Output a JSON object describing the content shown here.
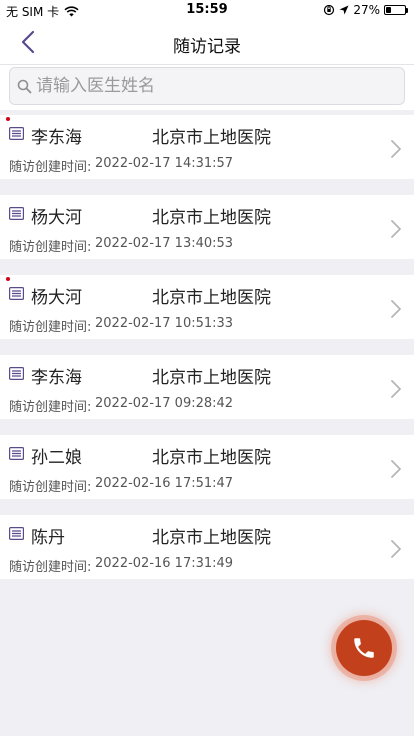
{
  "status_bar": {
    "carrier": "无 SIM 卡",
    "time": "15:59",
    "battery_percent": "27%",
    "battery_level": 0.27
  },
  "nav": {
    "title": "随访记录"
  },
  "search": {
    "placeholder": "请输入医生姓名"
  },
  "records": [
    {
      "name": "李东海",
      "hospital": "北京市上地医院",
      "time_label": "随访创建时间:",
      "time": "2022-02-17 14:31:57",
      "unread": true
    },
    {
      "name": "杨大河",
      "hospital": "北京市上地医院",
      "time_label": "随访创建时间:",
      "time": "2022-02-17 13:40:53",
      "unread": false
    },
    {
      "name": "杨大河",
      "hospital": "北京市上地医院",
      "time_label": "随访创建时间:",
      "time": "2022-02-17 10:51:33",
      "unread": true
    },
    {
      "name": "李东海",
      "hospital": "北京市上地医院",
      "time_label": "随访创建时间:",
      "time": "2022-02-17 09:28:42",
      "unread": false
    },
    {
      "name": "孙二娘",
      "hospital": "北京市上地医院",
      "time_label": "随访创建时间:",
      "time": "2022-02-16 17:51:47",
      "unread": false
    },
    {
      "name": "陈丹",
      "hospital": "北京市上地医院",
      "time_label": "随访创建时间:",
      "time": "2022-02-16 17:31:49",
      "unread": false
    }
  ],
  "colors": {
    "accent": "#5a4a8c",
    "call_button": "#c2411c",
    "unread_dot": "#d0021b"
  }
}
